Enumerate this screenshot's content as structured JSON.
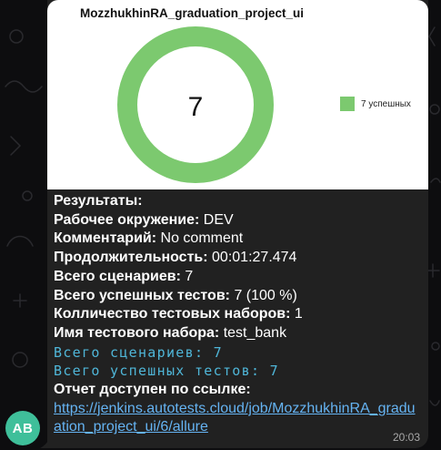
{
  "chat": {
    "avatar_initials": "AB",
    "time": "20:03"
  },
  "report_image": {
    "title": "MozzhukhinRA_graduation_project_ui",
    "center_value": "7",
    "legend_label": "7 успешных",
    "ring_color": "#7cc96f",
    "chart_data": {
      "type": "pie",
      "categories": [
        "7 успешных"
      ],
      "values": [
        7
      ],
      "colors": [
        "#7cc96f"
      ],
      "title": "MozzhukhinRA_graduation_project_ui",
      "legend": "right"
    }
  },
  "message": {
    "results_label": "Результаты:",
    "env_label": "Рабочее окружение:",
    "env_value": "DEV",
    "comment_label": "Комментарий:",
    "comment_value": "No comment",
    "duration_label": "Продолжительность:",
    "duration_value": "00:01:27.474",
    "scenarios_label": "Всего сценариев:",
    "scenarios_value": "7",
    "passed_label": "Всего успешных тестов:",
    "passed_value": "7 (100 %)",
    "suites_label": "Колличество тестовых наборов:",
    "suites_value": "1",
    "suite_name_label": "Имя тестового набора:",
    "suite_name_value": "test_bank",
    "mono_scenarios": "Всего сценариев: 7",
    "mono_passed": "Всего успешных тестов: 7",
    "report_label": "Отчет доступен по ссылке:",
    "report_link": "https://jenkins.autotests.cloud/job/MozzhukhinRA_graduation_project_ui/6/allure"
  },
  "colors": {
    "background": "#0d0d0f",
    "bubble": "#212121",
    "avatar": "#3fbf9a",
    "link": "#65b3f2",
    "mono_text": "#4fb6d8"
  }
}
